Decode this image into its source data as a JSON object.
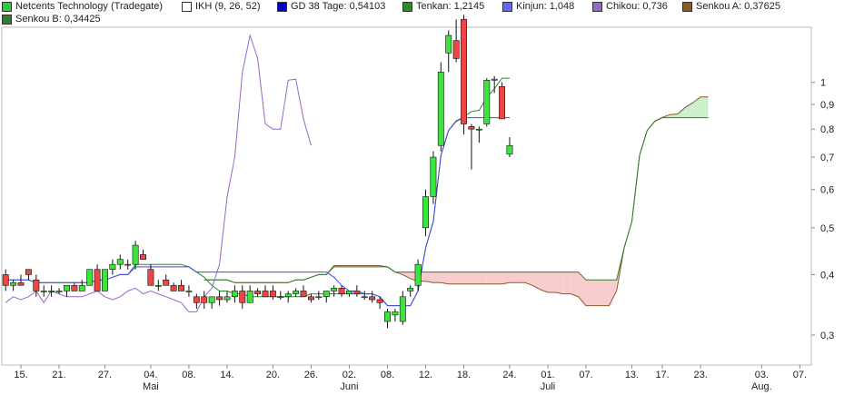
{
  "legend": [
    {
      "label": "Netcents Technology (Tradegate)",
      "color": "#2ecc40"
    },
    {
      "label": "IKH (9, 26, 52)",
      "color": "#ffffff"
    },
    {
      "label": "GD 38 Tage: 0,54103",
      "color": "#0000cc"
    },
    {
      "label": "Tenkan: 1,2145",
      "color": "#2a8a2a"
    },
    {
      "label": "Kinjun: 1,048",
      "color": "#6666ee"
    },
    {
      "label": "Chikou: 0,736",
      "color": "#9966cc"
    },
    {
      "label": "Senkou A: 0,37625",
      "color": "#8b5a2b"
    },
    {
      "label": "Senkou B: 0,34425",
      "color": "#2e7d32"
    }
  ],
  "colors": {
    "up": "#39e639",
    "down": "#ee4444",
    "tenkan": "#2a8a2a",
    "kijun": "#4444ee",
    "chikou": "#9966cc",
    "senkouA": "#8b5a2b",
    "senkouB": "#2e7d32",
    "ma": "#3333cc",
    "cloudBull": "#ccefcc",
    "cloudBear": "#f8cccc"
  },
  "chart_data": {
    "type": "candlestick",
    "yscale": "log",
    "ylim": [
      0.26,
      1.3
    ],
    "y_ticks": [
      "1",
      "0,9",
      "0,8",
      "0,7",
      "0,6",
      "0,5",
      "0,4",
      "0,3"
    ],
    "y_tick_values": [
      1,
      0.9,
      0.8,
      0.7,
      0.6,
      0.5,
      0.4,
      0.3
    ],
    "x_ticks": [
      "15.",
      "21.",
      "27.",
      "04.",
      "08.",
      "14.",
      "20.",
      "26.",
      "02.",
      "08.",
      "12.",
      "18.",
      "24.",
      "01.",
      "07.",
      "13.",
      "17.",
      "23.",
      "03.",
      "07."
    ],
    "month_labels": [
      {
        "label": "Mai",
        "after_tick": "04."
      },
      {
        "label": "Juni",
        "after_tick": "02."
      },
      {
        "label": "Juli",
        "after_tick": "01."
      },
      {
        "label": "Aug.",
        "after_tick": "03."
      }
    ],
    "candles": [
      {
        "o": 0.4,
        "h": 0.41,
        "l": 0.37,
        "c": 0.38
      },
      {
        "o": 0.38,
        "h": 0.39,
        "l": 0.37,
        "c": 0.385
      },
      {
        "o": 0.385,
        "h": 0.4,
        "l": 0.38,
        "c": 0.38
      },
      {
        "o": 0.41,
        "h": 0.41,
        "l": 0.39,
        "c": 0.4
      },
      {
        "o": 0.39,
        "h": 0.4,
        "l": 0.36,
        "c": 0.37
      },
      {
        "o": 0.37,
        "h": 0.38,
        "l": 0.36,
        "c": 0.37
      },
      {
        "o": 0.37,
        "h": 0.38,
        "l": 0.36,
        "c": 0.37
      },
      {
        "o": 0.37,
        "h": 0.375,
        "l": 0.365,
        "c": 0.37
      },
      {
        "o": 0.37,
        "h": 0.38,
        "l": 0.36,
        "c": 0.38
      },
      {
        "o": 0.38,
        "h": 0.385,
        "l": 0.37,
        "c": 0.37
      },
      {
        "o": 0.37,
        "h": 0.39,
        "l": 0.37,
        "c": 0.38
      },
      {
        "o": 0.38,
        "h": 0.41,
        "l": 0.38,
        "c": 0.41
      },
      {
        "o": 0.41,
        "h": 0.42,
        "l": 0.37,
        "c": 0.37
      },
      {
        "o": 0.37,
        "h": 0.41,
        "l": 0.37,
        "c": 0.41
      },
      {
        "o": 0.41,
        "h": 0.43,
        "l": 0.4,
        "c": 0.42
      },
      {
        "o": 0.42,
        "h": 0.44,
        "l": 0.41,
        "c": 0.43
      },
      {
        "o": 0.42,
        "h": 0.43,
        "l": 0.41,
        "c": 0.42
      },
      {
        "o": 0.42,
        "h": 0.47,
        "l": 0.41,
        "c": 0.46
      },
      {
        "o": 0.44,
        "h": 0.45,
        "l": 0.43,
        "c": 0.43
      },
      {
        "o": 0.41,
        "h": 0.42,
        "l": 0.38,
        "c": 0.38
      },
      {
        "o": 0.38,
        "h": 0.39,
        "l": 0.37,
        "c": 0.38
      },
      {
        "o": 0.39,
        "h": 0.4,
        "l": 0.38,
        "c": 0.38
      },
      {
        "o": 0.38,
        "h": 0.385,
        "l": 0.37,
        "c": 0.37
      },
      {
        "o": 0.38,
        "h": 0.39,
        "l": 0.37,
        "c": 0.37
      },
      {
        "o": 0.37,
        "h": 0.38,
        "l": 0.36,
        "c": 0.37
      },
      {
        "o": 0.36,
        "h": 0.365,
        "l": 0.34,
        "c": 0.35
      },
      {
        "o": 0.36,
        "h": 0.37,
        "l": 0.34,
        "c": 0.35
      },
      {
        "o": 0.35,
        "h": 0.36,
        "l": 0.34,
        "c": 0.36
      },
      {
        "o": 0.36,
        "h": 0.37,
        "l": 0.345,
        "c": 0.355
      },
      {
        "o": 0.355,
        "h": 0.37,
        "l": 0.35,
        "c": 0.36
      },
      {
        "o": 0.36,
        "h": 0.38,
        "l": 0.35,
        "c": 0.37
      },
      {
        "o": 0.37,
        "h": 0.38,
        "l": 0.34,
        "c": 0.35
      },
      {
        "o": 0.35,
        "h": 0.38,
        "l": 0.35,
        "c": 0.37
      },
      {
        "o": 0.37,
        "h": 0.375,
        "l": 0.36,
        "c": 0.365
      },
      {
        "o": 0.37,
        "h": 0.38,
        "l": 0.36,
        "c": 0.36
      },
      {
        "o": 0.37,
        "h": 0.38,
        "l": 0.355,
        "c": 0.36
      },
      {
        "o": 0.36,
        "h": 0.37,
        "l": 0.355,
        "c": 0.36
      },
      {
        "o": 0.36,
        "h": 0.37,
        "l": 0.35,
        "c": 0.365
      },
      {
        "o": 0.365,
        "h": 0.375,
        "l": 0.36,
        "c": 0.37
      },
      {
        "o": 0.37,
        "h": 0.38,
        "l": 0.36,
        "c": 0.36
      },
      {
        "o": 0.36,
        "h": 0.365,
        "l": 0.35,
        "c": 0.355
      },
      {
        "o": 0.36,
        "h": 0.37,
        "l": 0.355,
        "c": 0.36
      },
      {
        "o": 0.36,
        "h": 0.37,
        "l": 0.35,
        "c": 0.37
      },
      {
        "o": 0.37,
        "h": 0.38,
        "l": 0.36,
        "c": 0.375
      },
      {
        "o": 0.375,
        "h": 0.38,
        "l": 0.36,
        "c": 0.365
      },
      {
        "o": 0.365,
        "h": 0.37,
        "l": 0.36,
        "c": 0.37
      },
      {
        "o": 0.37,
        "h": 0.38,
        "l": 0.36,
        "c": 0.365
      },
      {
        "o": 0.36,
        "h": 0.37,
        "l": 0.355,
        "c": 0.36
      },
      {
        "o": 0.36,
        "h": 0.37,
        "l": 0.35,
        "c": 0.355
      },
      {
        "o": 0.355,
        "h": 0.36,
        "l": 0.34,
        "c": 0.35
      },
      {
        "o": 0.32,
        "h": 0.34,
        "l": 0.31,
        "c": 0.335
      },
      {
        "o": 0.33,
        "h": 0.34,
        "l": 0.32,
        "c": 0.335
      },
      {
        "o": 0.32,
        "h": 0.37,
        "l": 0.315,
        "c": 0.36
      },
      {
        "o": 0.37,
        "h": 0.38,
        "l": 0.36,
        "c": 0.375
      },
      {
        "o": 0.38,
        "h": 0.43,
        "l": 0.37,
        "c": 0.42
      },
      {
        "o": 0.5,
        "h": 0.6,
        "l": 0.48,
        "c": 0.58
      },
      {
        "o": 0.58,
        "h": 0.72,
        "l": 0.56,
        "c": 0.7
      },
      {
        "o": 0.74,
        "h": 1.1,
        "l": 0.72,
        "c": 1.05
      },
      {
        "o": 1.15,
        "h": 1.28,
        "l": 1.05,
        "c": 1.25
      },
      {
        "o": 1.22,
        "h": 1.35,
        "l": 1.1,
        "c": 1.12
      },
      {
        "o": 1.35,
        "h": 1.38,
        "l": 0.78,
        "c": 0.82
      },
      {
        "o": 0.81,
        "h": 0.82,
        "l": 0.66,
        "c": 0.8
      },
      {
        "o": 0.8,
        "h": 0.81,
        "l": 0.75,
        "c": 0.8
      },
      {
        "o": 0.82,
        "h": 1.02,
        "l": 0.81,
        "c": 1.01
      },
      {
        "o": 1.01,
        "h": 1.03,
        "l": 0.95,
        "c": 1.015
      },
      {
        "o": 0.98,
        "h": 1.0,
        "l": 0.84,
        "c": 0.84
      },
      {
        "o": 0.71,
        "h": 0.77,
        "l": 0.7,
        "c": 0.74
      }
    ],
    "ticks_pos": [
      2,
      7,
      13,
      19,
      24,
      29,
      35,
      40,
      45,
      50,
      55,
      60,
      66,
      71,
      76,
      82,
      86,
      91,
      99,
      104
    ]
  }
}
